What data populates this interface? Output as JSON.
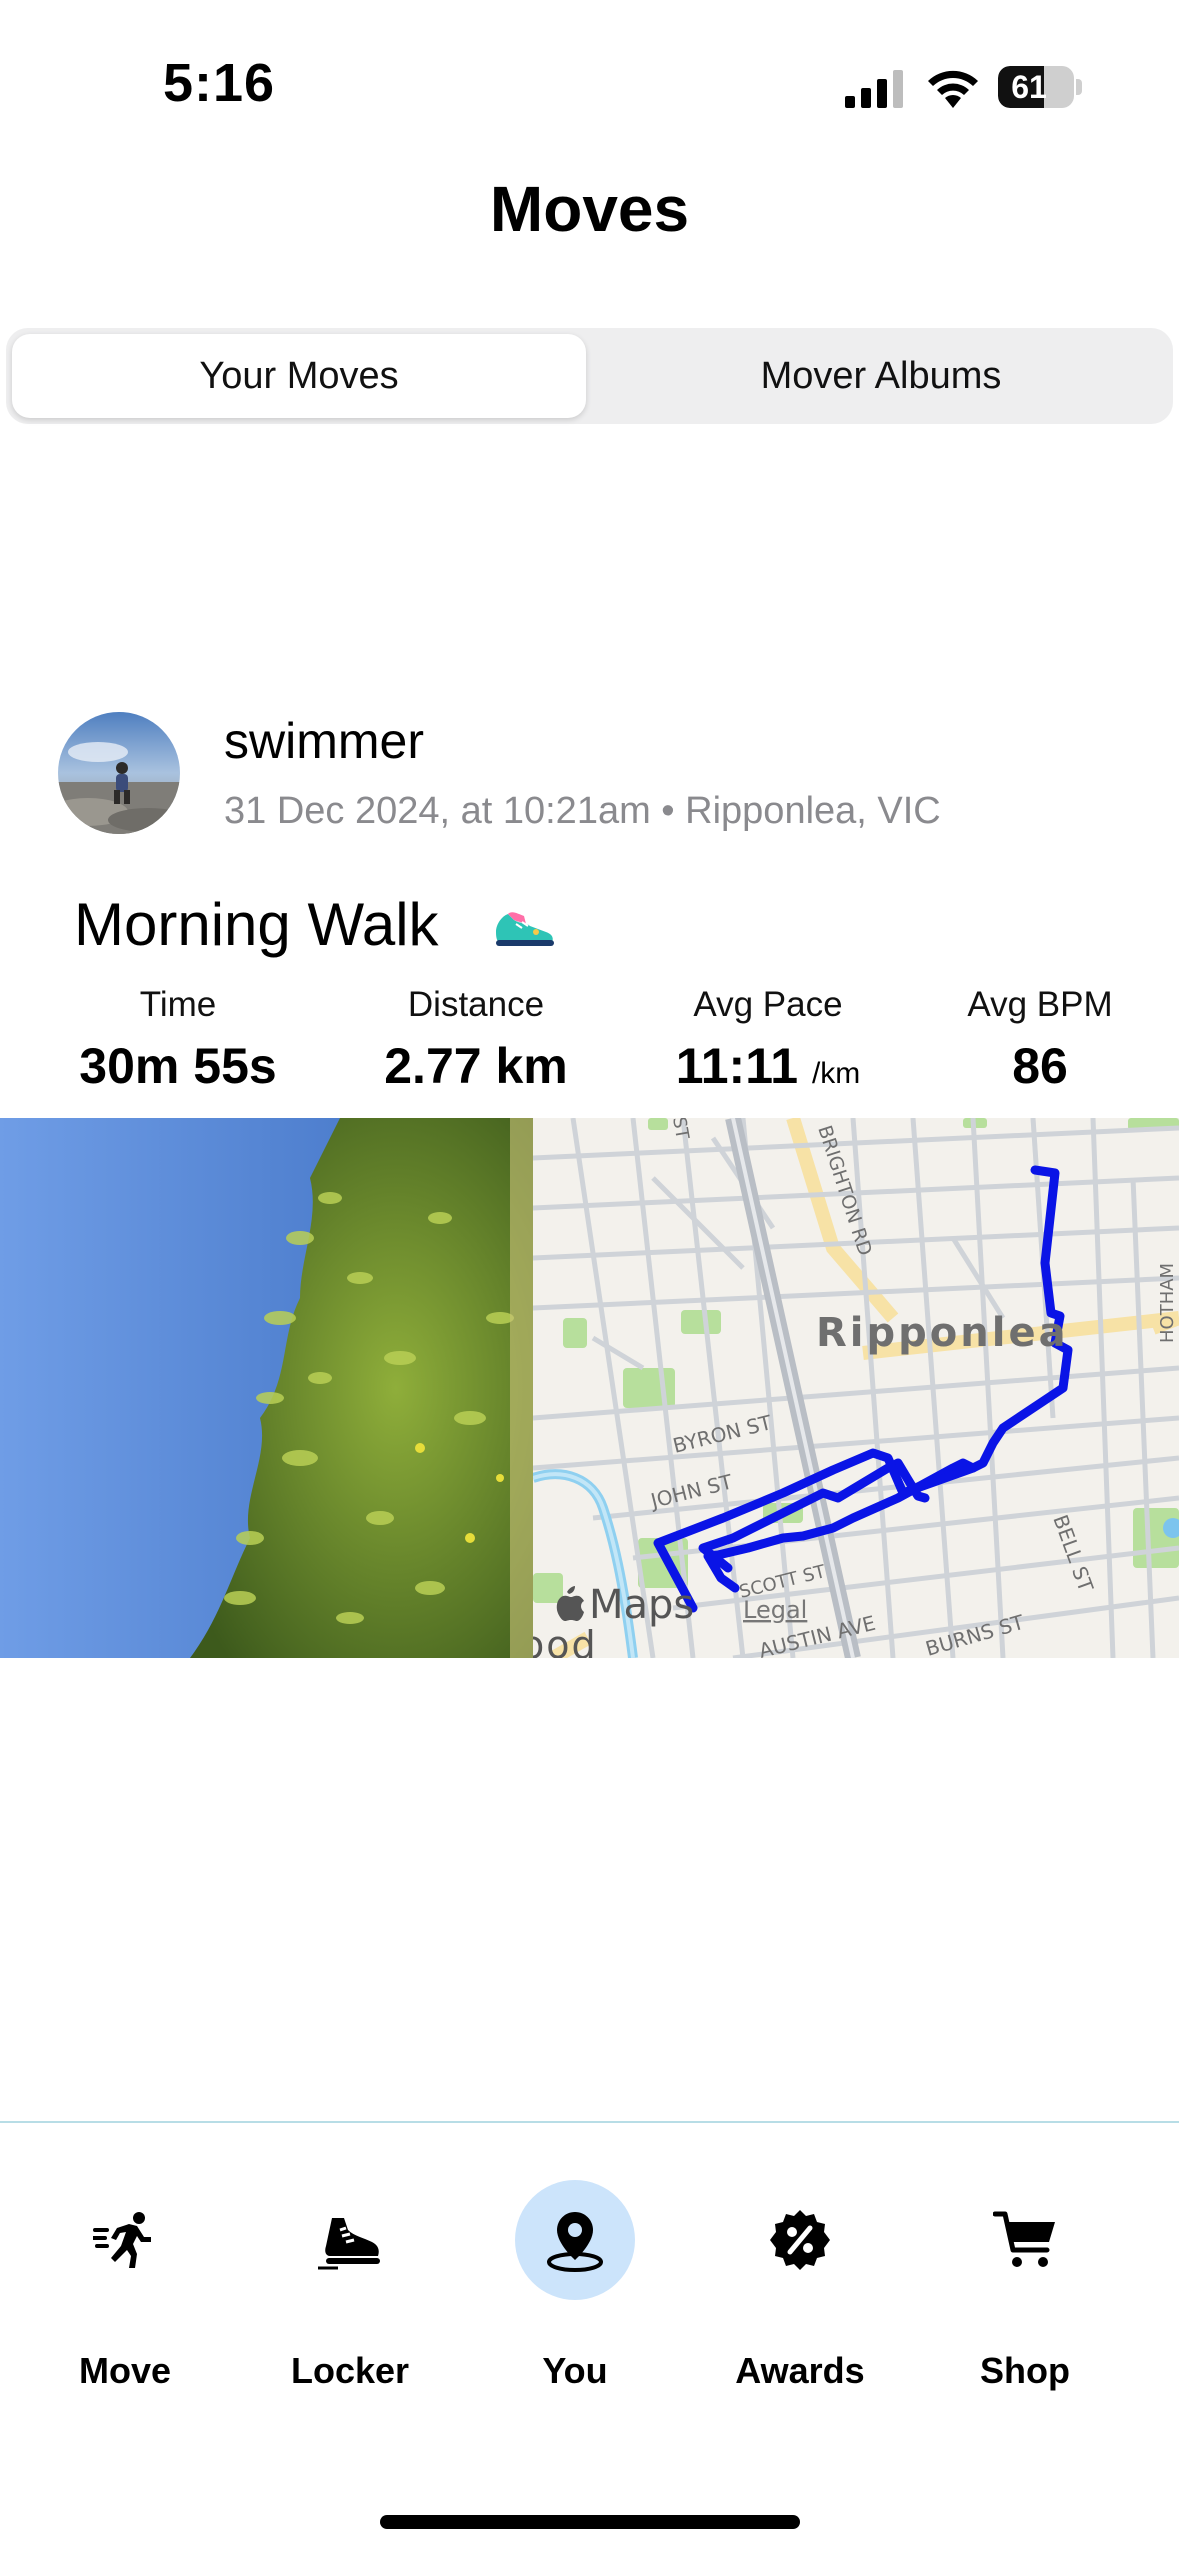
{
  "status_bar": {
    "time": "5:16",
    "battery_percent": "61",
    "battery_level": 0.61
  },
  "page_title": "Moves",
  "segmented_control": {
    "tabs": [
      "Your Moves",
      "Mover Albums"
    ],
    "selected": "Your Moves"
  },
  "post": {
    "username": "swimmer",
    "meta": "31 Dec 2024, at 10:21am • Ripponlea, VIC",
    "activity_title": "Morning Walk",
    "stats": [
      {
        "label": "Time",
        "value": "30m 55s",
        "unit": ""
      },
      {
        "label": "Distance",
        "value": "2.77 km",
        "unit": ""
      },
      {
        "label": "Avg Pace",
        "value": "11:11",
        "unit": "/km"
      },
      {
        "label": "Avg BPM",
        "value": "86",
        "unit": ""
      }
    ],
    "map": {
      "suburb_label": "Ripponlea",
      "streets": [
        "BYRON ST",
        "JOHN ST",
        "SCOTT ST",
        "AUSTIN AVE",
        "BURNS ST",
        "BELL ST",
        "BRIGHTON RD",
        "HOTHAM",
        "ST"
      ],
      "attribution": "Maps",
      "legal": "Legal",
      "partial_label": "ood",
      "route_color": "#0a14e6"
    }
  },
  "nav": {
    "items": [
      {
        "label": "Move",
        "icon": "running-person-icon"
      },
      {
        "label": "Locker",
        "icon": "sneaker-icon"
      },
      {
        "label": "You",
        "icon": "location-pin-icon"
      },
      {
        "label": "Awards",
        "icon": "percent-badge-icon"
      },
      {
        "label": "Shop",
        "icon": "shopping-cart-icon"
      }
    ],
    "active": "You"
  },
  "colors": {
    "accent_active_bg": "#cce4fb",
    "route": "#0a14e6",
    "meta_gray": "#8a8a8e"
  }
}
